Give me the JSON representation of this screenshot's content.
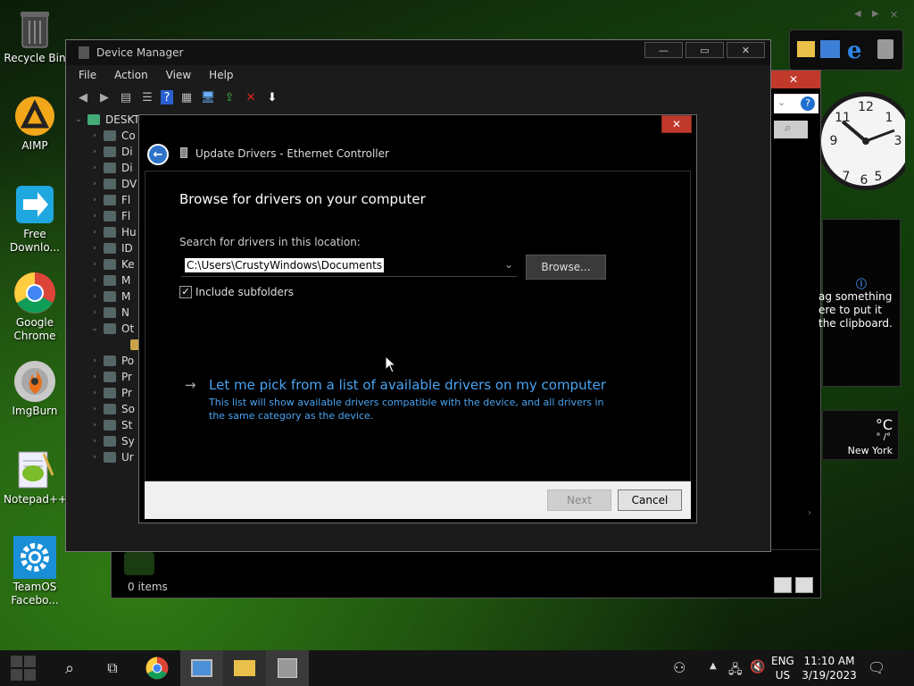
{
  "desktop": {
    "icons": [
      {
        "label": "Recycle Bin",
        "icon": "recycle-bin-icon"
      },
      {
        "label": "AIMP",
        "icon": "aimp-icon"
      },
      {
        "label": "Free Downlo...",
        "icon": "free-download-manager-icon"
      },
      {
        "label": "Google Chrome",
        "icon": "chrome-icon"
      },
      {
        "label": "ImgBurn",
        "icon": "imgburn-icon"
      },
      {
        "label": "Notepad++",
        "icon": "notepad-plus-plus-icon"
      },
      {
        "label": "TeamOS Facebo...",
        "icon": "gear-icon"
      }
    ]
  },
  "widgets": {
    "clipboard_text": "ag something ere to put it the clipboard.",
    "weather_unit": "°C",
    "weather_sub": "° /°",
    "weather_city": "New York"
  },
  "explorer": {
    "status_items": "0 items"
  },
  "device_manager": {
    "title": "Device Manager",
    "menu": [
      "File",
      "Action",
      "View",
      "Help"
    ],
    "tree_root": "DESKT",
    "tree_items": [
      "Co",
      "Di",
      "Di",
      "DV",
      "Fl",
      "Fl",
      "Hu",
      "ID",
      "Ke",
      "M",
      "M",
      "N",
      "Ot",
      "",
      "Po",
      "Pr",
      "Pr",
      "So",
      "St",
      "Sy",
      "Ur"
    ]
  },
  "dialog": {
    "title": "Update Drivers - Ethernet Controller",
    "heading": "Browse for drivers on your computer",
    "search_label": "Search for drivers in this location:",
    "path_value": "C:\\Users\\CrustyWindows\\Documents",
    "browse_label": "Browse...",
    "include_subfolders_label": "Include subfolders",
    "include_subfolders_checked": true,
    "pick_link": "Let me pick from a list of available drivers on my computer",
    "pick_desc": "This list will show available drivers compatible with the device, and all drivers in the same category as the device.",
    "next_label": "Next",
    "cancel_label": "Cancel",
    "close_glyph": "✕"
  },
  "taskbar": {
    "lang_line1": "ENG",
    "lang_line2": "US",
    "time": "11:10 AM",
    "date": "3/19/2023"
  },
  "colors": {
    "link_blue": "#4aa3f0",
    "close_red": "#c0392b"
  }
}
